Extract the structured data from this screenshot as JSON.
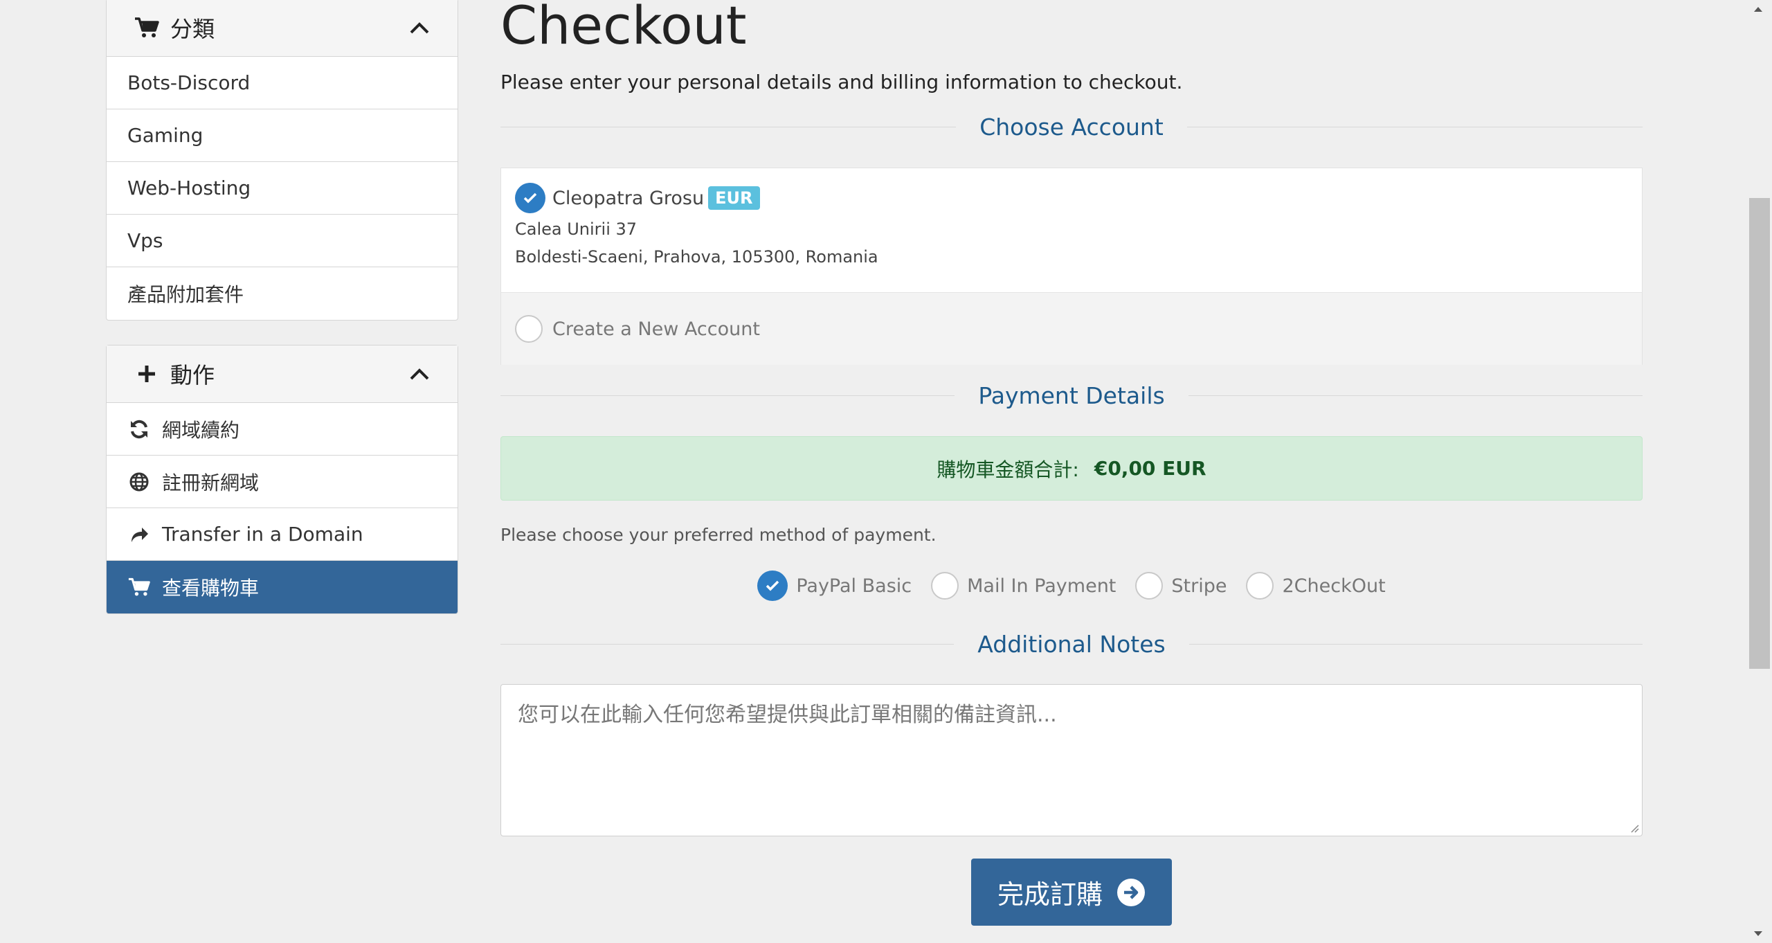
{
  "sidebar": {
    "categories": {
      "title": "分類",
      "items": [
        {
          "label": "Bots-Discord"
        },
        {
          "label": "Gaming"
        },
        {
          "label": "Web-Hosting"
        },
        {
          "label": "Vps"
        },
        {
          "label": "產品附加套件"
        }
      ]
    },
    "actions": {
      "title": "動作",
      "items": [
        {
          "label": "網域續約",
          "icon": "refresh-icon"
        },
        {
          "label": "註冊新網域",
          "icon": "globe-icon"
        },
        {
          "label": "Transfer in a Domain",
          "icon": "share-arrow-icon"
        },
        {
          "label": "查看購物車",
          "icon": "cart-icon",
          "active": true
        }
      ]
    }
  },
  "main": {
    "title": "Checkout",
    "subtitle": "Please enter your personal details and billing information to checkout.",
    "choose_account": {
      "heading": "Choose Account",
      "selected": {
        "name": "Cleopatra Grosu",
        "currency": "EUR",
        "address1": "Calea Unirii 37",
        "address2": "Boldesti-Scaeni, Prahova, 105300, Romania"
      },
      "new_account_label": "Create a New Account"
    },
    "payment": {
      "heading": "Payment Details",
      "total_label": "購物車金額合計:",
      "total_value": "€0,00 EUR",
      "choose_text": "Please choose your preferred method of payment.",
      "methods": [
        {
          "label": "PayPal Basic",
          "selected": true
        },
        {
          "label": "Mail In Payment",
          "selected": false
        },
        {
          "label": "Stripe",
          "selected": false
        },
        {
          "label": "2CheckOut",
          "selected": false
        }
      ]
    },
    "notes": {
      "heading": "Additional Notes",
      "placeholder": "您可以在此輸入任何您希望提供與此訂單相關的備註資訊..."
    },
    "submit_label": "完成訂購"
  },
  "colors": {
    "primary": "#336699",
    "radio": "#2d7dc4",
    "badge": "#5bc0de",
    "success_bg": "#d4edda",
    "success_text": "#155724",
    "heading_blue": "#1d5a8c"
  }
}
